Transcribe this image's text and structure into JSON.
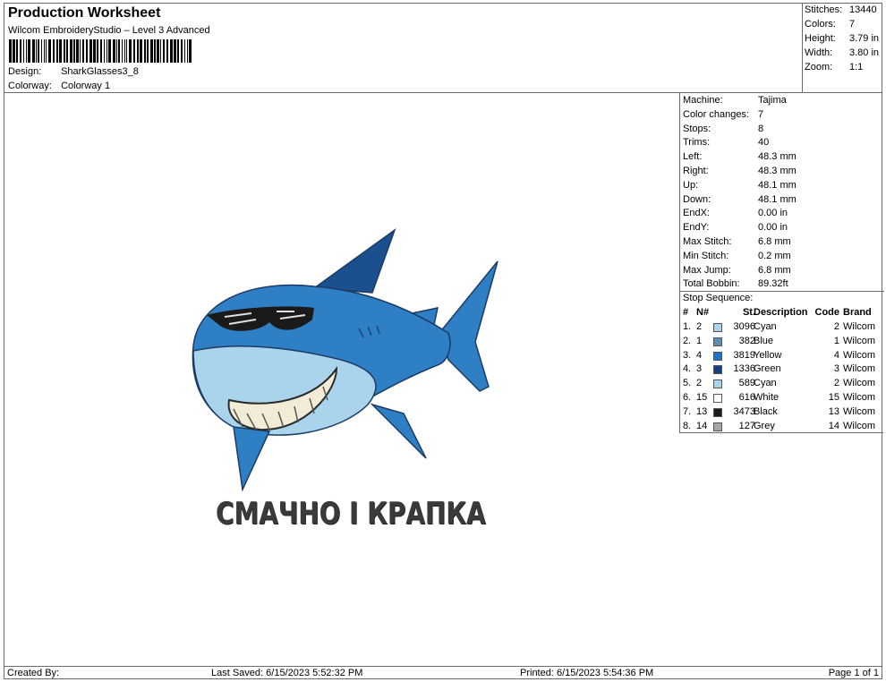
{
  "header": {
    "title": "Production Worksheet",
    "subtitle": "Wilcom EmbroideryStudio – Level 3 Advanced",
    "design_label": "Design:",
    "design_value": "SharkGlasses3_8",
    "colorway_label": "Colorway:",
    "colorway_value": "Colorway 1"
  },
  "summary": {
    "stitches_label": "Stitches:",
    "stitches": "13440",
    "colors_label": "Colors:",
    "colors": "7",
    "height_label": "Height:",
    "height": "3.79 in",
    "width_label": "Width:",
    "width": "3.80 in",
    "zoom_label": "Zoom:",
    "zoom": "1:1"
  },
  "info": [
    {
      "k": "Machine:",
      "v": "Tajima"
    },
    {
      "k": "Color changes:",
      "v": "7"
    },
    {
      "k": "Stops:",
      "v": "8"
    },
    {
      "k": "Trims:",
      "v": "40"
    },
    {
      "k": "Left:",
      "v": "48.3 mm"
    },
    {
      "k": "Right:",
      "v": "48.3 mm"
    },
    {
      "k": "Up:",
      "v": "48.1 mm"
    },
    {
      "k": "Down:",
      "v": "48.1 mm"
    },
    {
      "k": "EndX:",
      "v": "0.00 in"
    },
    {
      "k": "EndY:",
      "v": "0.00 in"
    },
    {
      "k": "Max Stitch:",
      "v": "6.8 mm"
    },
    {
      "k": "Min Stitch:",
      "v": "0.2 mm"
    },
    {
      "k": "Max Jump:",
      "v": "6.8 mm"
    },
    {
      "k": "Total Bobbin:",
      "v": "89.32ft"
    }
  ],
  "sequence": {
    "title": "Stop Sequence:",
    "headers": {
      "ix": "#",
      "n": "N#",
      "st": "St.",
      "desc": "Description",
      "code": "Code",
      "brand": "Brand"
    },
    "rows": [
      {
        "ix": "1.",
        "n": "2",
        "st": "3096",
        "desc": "Cyan",
        "code": "2",
        "brand": "Wilcom",
        "color": "#a9d4ec"
      },
      {
        "ix": "2.",
        "n": "1",
        "st": "382",
        "desc": "Blue",
        "code": "1",
        "brand": "Wilcom",
        "color": "#5b8fb8"
      },
      {
        "ix": "3.",
        "n": "4",
        "st": "3819",
        "desc": "Yellow",
        "code": "4",
        "brand": "Wilcom",
        "color": "#1e73c8"
      },
      {
        "ix": "4.",
        "n": "3",
        "st": "1336",
        "desc": "Green",
        "code": "3",
        "brand": "Wilcom",
        "color": "#123f86"
      },
      {
        "ix": "5.",
        "n": "2",
        "st": "589",
        "desc": "Cyan",
        "code": "2",
        "brand": "Wilcom",
        "color": "#a9d4ec"
      },
      {
        "ix": "6.",
        "n": "15",
        "st": "616",
        "desc": "White",
        "code": "15",
        "brand": "Wilcom",
        "color": "#ffffff"
      },
      {
        "ix": "7.",
        "n": "13",
        "st": "3473",
        "desc": "Black",
        "code": "13",
        "brand": "Wilcom",
        "color": "#1a1a1a"
      },
      {
        "ix": "8.",
        "n": "14",
        "st": "127",
        "desc": "Grey",
        "code": "14",
        "brand": "Wilcom",
        "color": "#a6a6a6"
      }
    ]
  },
  "design": {
    "caption": "СМАЧНО І КРАПКА",
    "body_color": "#2f7fc4",
    "dark_color": "#1b4f8e",
    "belly_color": "#a9d4ec"
  },
  "footer": {
    "created_by": "Created By:",
    "last_saved": "Last Saved: 6/15/2023 5:52:32 PM",
    "printed": "Printed: 6/15/2023 5:54:36 PM",
    "page": "Page 1 of 1"
  }
}
